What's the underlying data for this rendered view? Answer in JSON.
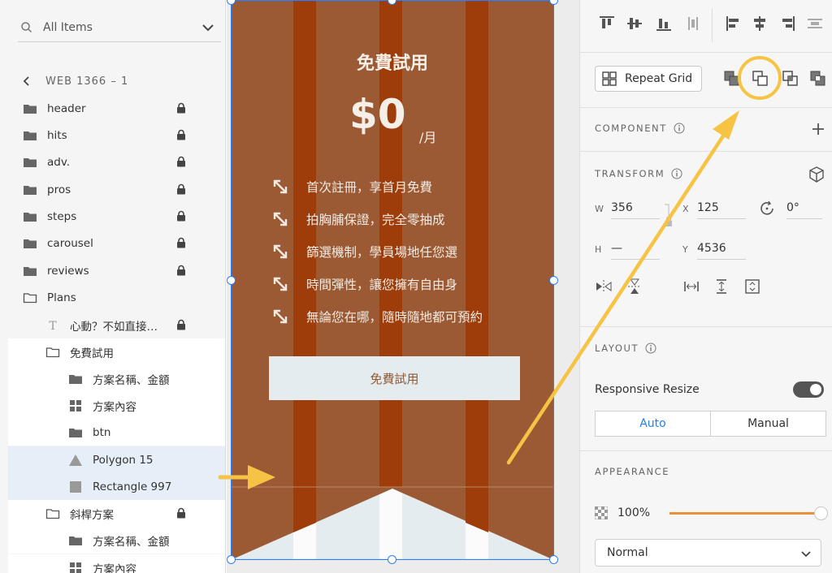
{
  "colors": {
    "card_brown": "#9b5a33",
    "column_dark": "#9e3c0a",
    "accent_blue": "#2680eb",
    "annotation_yellow": "#f6c344",
    "slider_orange": "#e8923a"
  },
  "layers_panel": {
    "search": {
      "label": "All Items"
    },
    "breadcrumb": "WEB 1366 – 1",
    "items": [
      {
        "label": "header",
        "icon": "folder-icon",
        "locked": true
      },
      {
        "label": "hits",
        "icon": "folder-icon",
        "locked": true
      },
      {
        "label": "adv.",
        "icon": "folder-icon",
        "locked": true
      },
      {
        "label": "pros",
        "icon": "folder-icon",
        "locked": true
      },
      {
        "label": "steps",
        "icon": "folder-icon",
        "locked": true
      },
      {
        "label": "carousel",
        "icon": "folder-icon",
        "locked": true
      },
      {
        "label": "reviews",
        "icon": "folder-icon",
        "locked": true
      },
      {
        "label": "Plans",
        "icon": "folder-open-icon",
        "locked": false
      },
      {
        "label": "心動？不如直接…",
        "icon": "text-icon",
        "locked": true
      },
      {
        "label": "免費試用",
        "icon": "folder-open-icon",
        "locked": false
      },
      {
        "label": "方案名稱、金額",
        "icon": "folder-icon",
        "locked": false
      },
      {
        "label": "方案內容",
        "icon": "repeat-grid-icon",
        "locked": false
      },
      {
        "label": "btn",
        "icon": "folder-icon",
        "locked": false
      },
      {
        "label": "Polygon 15",
        "icon": "triangle-icon",
        "locked": false
      },
      {
        "label": "Rectangle 997",
        "icon": "rectangle-icon",
        "locked": false
      },
      {
        "label": "斜桿方案",
        "icon": "folder-open-icon",
        "locked": true
      },
      {
        "label": "方案名稱、金額",
        "icon": "folder-icon",
        "locked": false
      },
      {
        "label": "方案內容",
        "icon": "repeat-grid-icon",
        "locked": false
      }
    ]
  },
  "canvas": {
    "card_title": "免費試用",
    "price": "$0",
    "per": "/月",
    "features": [
      "首次註冊，享首月免費",
      "拍胸脯保證，完全零抽成",
      "篩選機制，學員場地任您選",
      "時間彈性，讓您擁有自由身",
      "無論您在哪，隨時隨地都可預約"
    ],
    "cta": "免費試用"
  },
  "props_panel": {
    "repeat_grid": "Repeat Grid",
    "component": {
      "title": "COMPONENT"
    },
    "transform": {
      "title": "TRANSFORM",
      "w_label": "W",
      "w": "356",
      "x_label": "X",
      "x": "125",
      "rotation": "0°",
      "h_label": "H",
      "h": "—",
      "y_label": "Y",
      "y": "4536"
    },
    "layout": {
      "title": "LAYOUT",
      "responsive_resize": "Responsive Resize",
      "auto": "Auto",
      "manual": "Manual"
    },
    "appearance": {
      "title": "APPEARANCE",
      "opacity": "100%",
      "opacity_value": 1.0,
      "blend_mode": "Normal"
    }
  }
}
